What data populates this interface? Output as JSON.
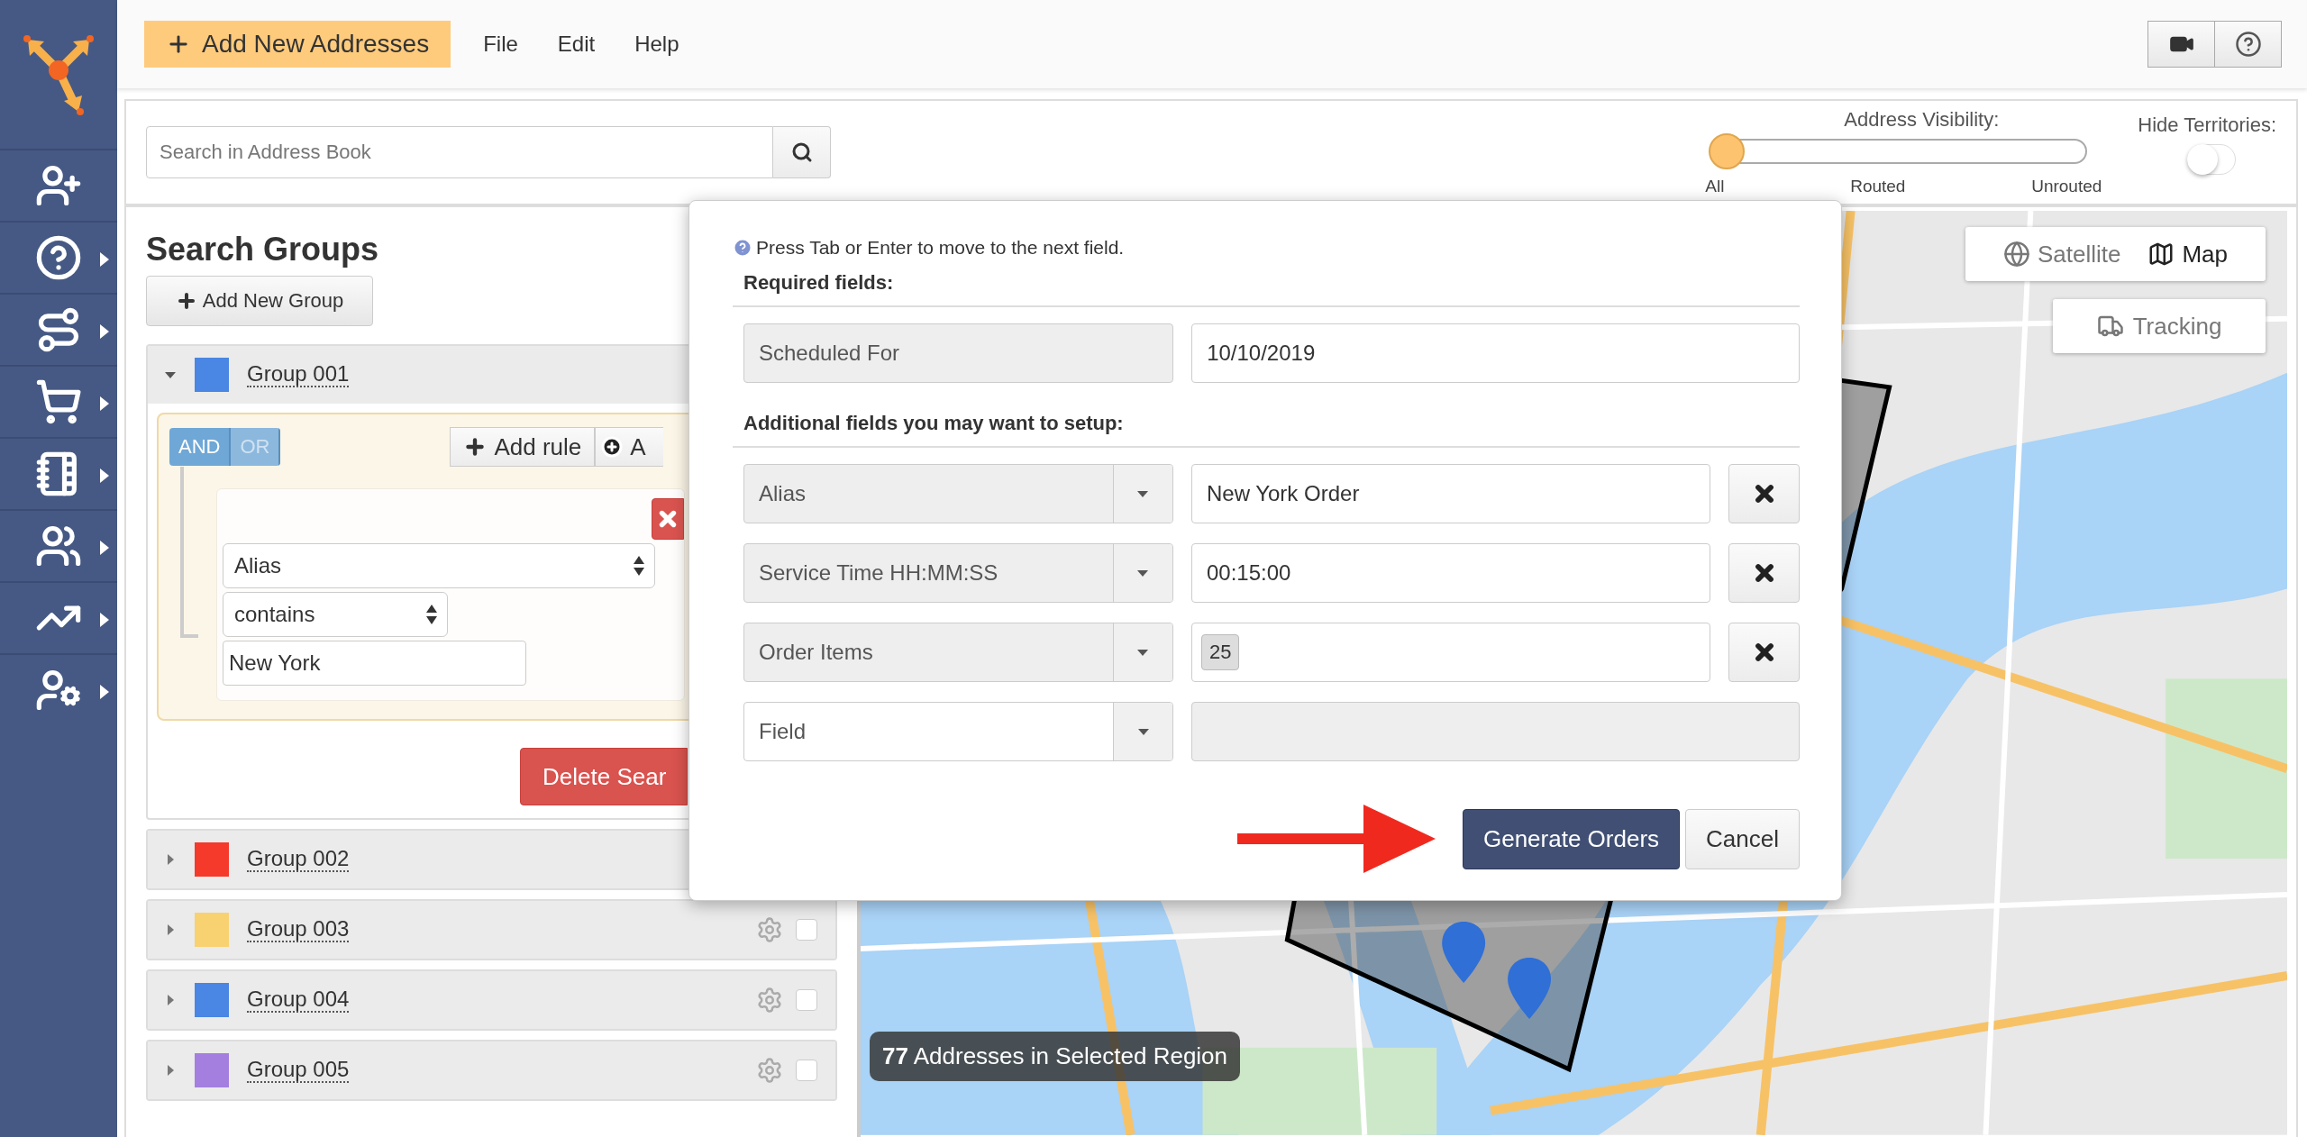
{
  "sidebar": {
    "items": [
      {
        "kind": "add-user",
        "submenu": false
      },
      {
        "kind": "help",
        "submenu": true
      },
      {
        "kind": "routes",
        "submenu": true
      },
      {
        "kind": "cart",
        "submenu": true
      },
      {
        "kind": "address-book",
        "submenu": true
      },
      {
        "kind": "team",
        "submenu": true
      },
      {
        "kind": "analytics",
        "submenu": true
      },
      {
        "kind": "user-settings",
        "submenu": true
      }
    ]
  },
  "toolbar": {
    "add_button": "Add New Addresses",
    "menus": [
      "File",
      "Edit",
      "Help"
    ]
  },
  "search": {
    "placeholder": "Search in Address Book"
  },
  "visibility": {
    "label": "Address Visibility:",
    "level": 0,
    "stops": [
      "All",
      "Routed",
      "Unrouted"
    ]
  },
  "hide_territories": {
    "label": "Hide Territories:",
    "on": false
  },
  "search_groups": {
    "title": "Search Groups",
    "add_button": "Add New Group",
    "groups": [
      {
        "name": "Group 001",
        "color": "#4a86e3",
        "expanded": true
      },
      {
        "name": "Group 002",
        "color": "#f5392b",
        "expanded": false
      },
      {
        "name": "Group 003",
        "color": "#f8d170",
        "expanded": false,
        "checked": false
      },
      {
        "name": "Group 004",
        "color": "#4a86e3",
        "expanded": false,
        "checked": false
      },
      {
        "name": "Group 005",
        "color": "#a47fe0",
        "expanded": false,
        "checked": false
      }
    ]
  },
  "rule_builder": {
    "conditions": [
      {
        "label": "AND",
        "selected": true
      },
      {
        "label": "OR",
        "selected": false
      }
    ],
    "add_rule": "Add rule",
    "add_group": "A",
    "rule": {
      "field": "Alias",
      "operator": "contains",
      "value": "New York"
    },
    "delete_button": "Delete Sear"
  },
  "map": {
    "view_options": [
      {
        "label": "Satellite",
        "selected": false
      },
      {
        "label": "Map",
        "selected": true
      }
    ],
    "tracking": "Tracking",
    "selection": "**77** Addresses in Selected Region"
  },
  "dialog": {
    "hint": "Press Tab or Enter to move to the next field.",
    "required_title": "Required fields:",
    "required": [
      {
        "label": "Scheduled For",
        "value": "10/10/2019"
      }
    ],
    "additional_title": "Additional fields you may want to setup:",
    "fields": [
      {
        "kind": "text",
        "label": "Alias",
        "value": "New York Order"
      },
      {
        "kind": "text",
        "label": "Service Time HH:MM:SS",
        "value": "00:15:00"
      },
      {
        "kind": "tag",
        "label": "Order Items",
        "value": "25"
      },
      {
        "kind": "empty",
        "placeholder": "Field"
      }
    ],
    "buttons": [
      {
        "label": "Generate Orders",
        "kind": "primary"
      },
      {
        "label": "Cancel",
        "kind": "default"
      }
    ]
  }
}
